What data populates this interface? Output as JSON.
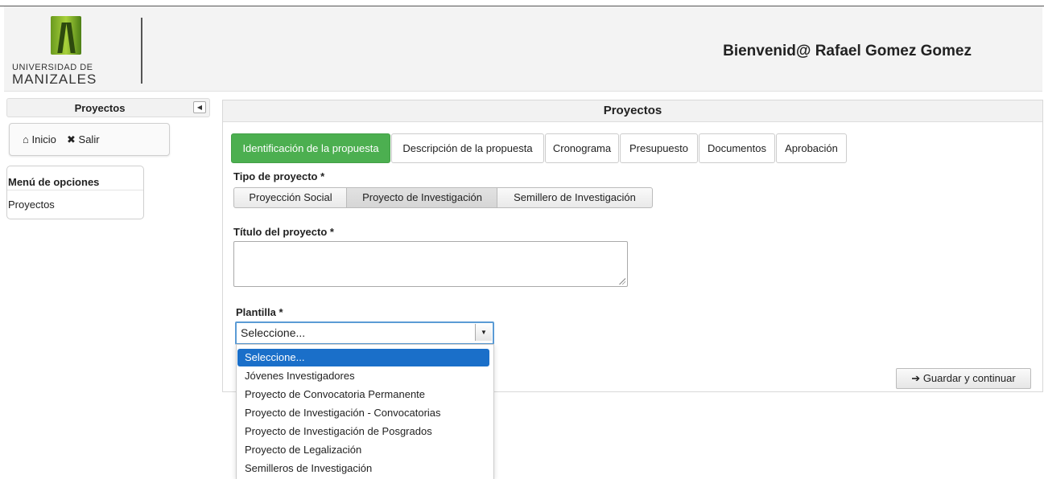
{
  "header": {
    "logo_line1": "UNIVERSIDAD DE",
    "logo_line2": "MANIZALES",
    "welcome": "Bienvenid@ Rafael Gomez Gomez"
  },
  "sidebar": {
    "title": "Proyectos",
    "collapse_icon": "triangle-left-icon",
    "nav": [
      {
        "icon": "home-icon",
        "icon_glyph": "⌂",
        "label": "Inicio"
      },
      {
        "icon": "close-icon",
        "icon_glyph": "✖",
        "label": "Salir"
      }
    ],
    "menu_title": "Menú de opciones",
    "menu_items": [
      "Proyectos"
    ]
  },
  "main": {
    "title": "Proyectos",
    "tabs": [
      "Identificación de la propuesta",
      "Descripción de la propuesta",
      "Cronograma",
      "Presupuesto",
      "Documentos",
      "Aprobación"
    ],
    "active_tab": "Identificación de la propuesta",
    "project_type_label": "Tipo de proyecto *",
    "project_types": [
      "Proyección Social",
      "Proyecto de Investigación",
      "Semillero de Investigación"
    ],
    "selected_project_type": "Proyecto de Investigación",
    "title_label": "Título del proyecto *",
    "title_value": "",
    "template_label": "Plantilla *",
    "template_selected": "Seleccione...",
    "template_options": [
      "Seleccione...",
      "Jóvenes Investigadores",
      "Proyecto de Convocatoria Permanente",
      "Proyecto de Investigación - Convocatorias",
      "Proyecto de Investigación de Posgrados",
      "Proyecto de Legalización",
      "Semilleros de Investigación"
    ],
    "save_icon": "arrow-right-icon",
    "save_label": "Guardar y continuar",
    "accent_color": "#4caf50",
    "select_highlight_color": "#1a6fc9"
  }
}
